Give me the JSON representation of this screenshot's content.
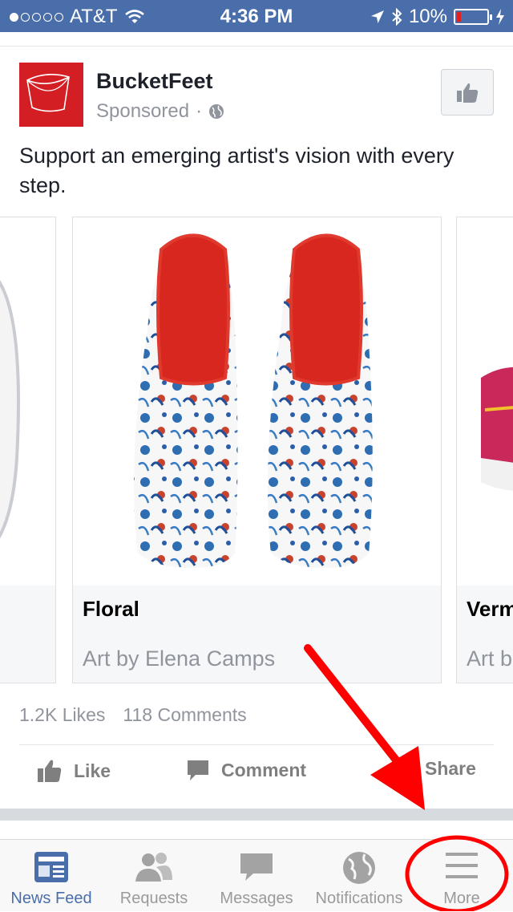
{
  "status_bar": {
    "carrier": "AT&T",
    "time": "4:36 PM",
    "battery": "10%"
  },
  "post": {
    "page_name": "BucketFeet",
    "sponsored_label": "Sponsored",
    "separator": "·",
    "text": "Support an emerging artist's vision with every step.",
    "carousel": [
      {
        "title": "",
        "subtitle": ""
      },
      {
        "title": "Floral",
        "subtitle": "Art by Elena Camps"
      },
      {
        "title": "Verm",
        "subtitle": "Art b"
      }
    ],
    "likes": "1.2K Likes",
    "comments": "118 Comments",
    "actions": {
      "like": "Like",
      "comment": "Comment",
      "share": "Share"
    }
  },
  "tab_bar": {
    "items": [
      {
        "label": "News Feed",
        "icon": "news-feed-icon"
      },
      {
        "label": "Requests",
        "icon": "friends-icon"
      },
      {
        "label": "Messages",
        "icon": "chat-bubble-icon"
      },
      {
        "label": "Notifications",
        "icon": "globe-icon"
      },
      {
        "label": "More",
        "icon": "menu-icon"
      }
    ]
  },
  "colors": {
    "brand_blue": "#4a6eaa",
    "annotation_red": "#ff0000",
    "logo_red": "#d31f24"
  }
}
